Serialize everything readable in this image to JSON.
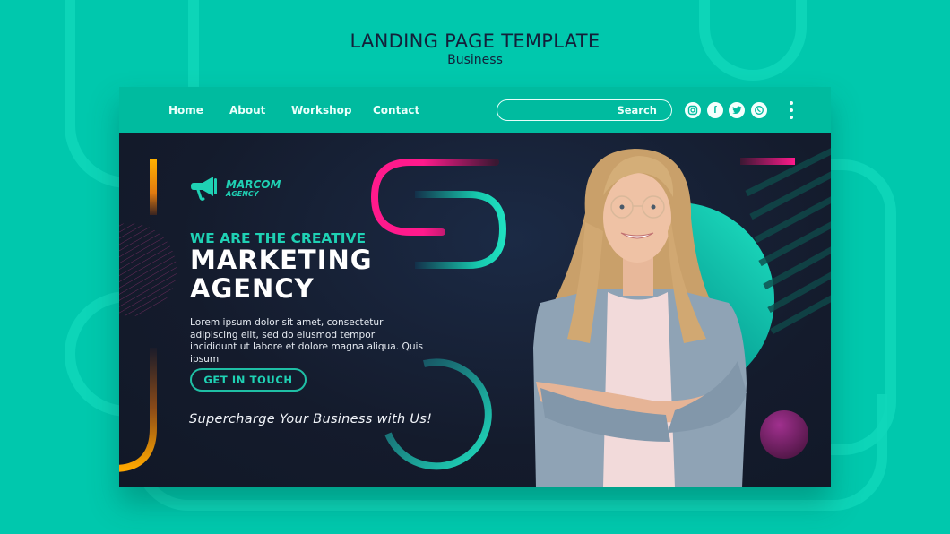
{
  "header": {
    "title": "LANDING PAGE TEMPLATE",
    "subtitle": "Business"
  },
  "nav": {
    "items": [
      {
        "label": "Home"
      },
      {
        "label": "About"
      },
      {
        "label": "Workshop"
      },
      {
        "label": "Contact"
      }
    ],
    "search": {
      "label": "Search",
      "value": ""
    },
    "social": [
      {
        "icon": "instagram-icon"
      },
      {
        "icon": "facebook-icon"
      },
      {
        "icon": "twitter-icon"
      },
      {
        "icon": "whatsapp-icon"
      }
    ],
    "menu_icon": "kebab-menu-icon"
  },
  "hero": {
    "logo": {
      "name": "MARCOM",
      "sub": "AGENCY",
      "icon": "megaphone-icon"
    },
    "eyebrow": "WE ARE THE CREATIVE",
    "headline_1": "MARKETING",
    "headline_2": "AGENCY",
    "body": "Lorem ipsum dolor sit amet, consectetur adipiscing elit, sed do eiusmod tempor incididunt ut labore et dolore magna aliqua. Quis ipsum",
    "cta_label": "GET  IN TOUCH",
    "tagline": "Supercharge Your Business with Us!",
    "image": "smiling-woman-with-glasses-arms-crossed"
  },
  "colors": {
    "background": "#00c8ad",
    "nav": "#00bb9f",
    "hero_dark": "#141b2c",
    "accent_teal": "#1fd1b4",
    "accent_pink": "#ff1a8c",
    "accent_orange": "#ffa800",
    "accent_purple": "#9b2a8a"
  }
}
